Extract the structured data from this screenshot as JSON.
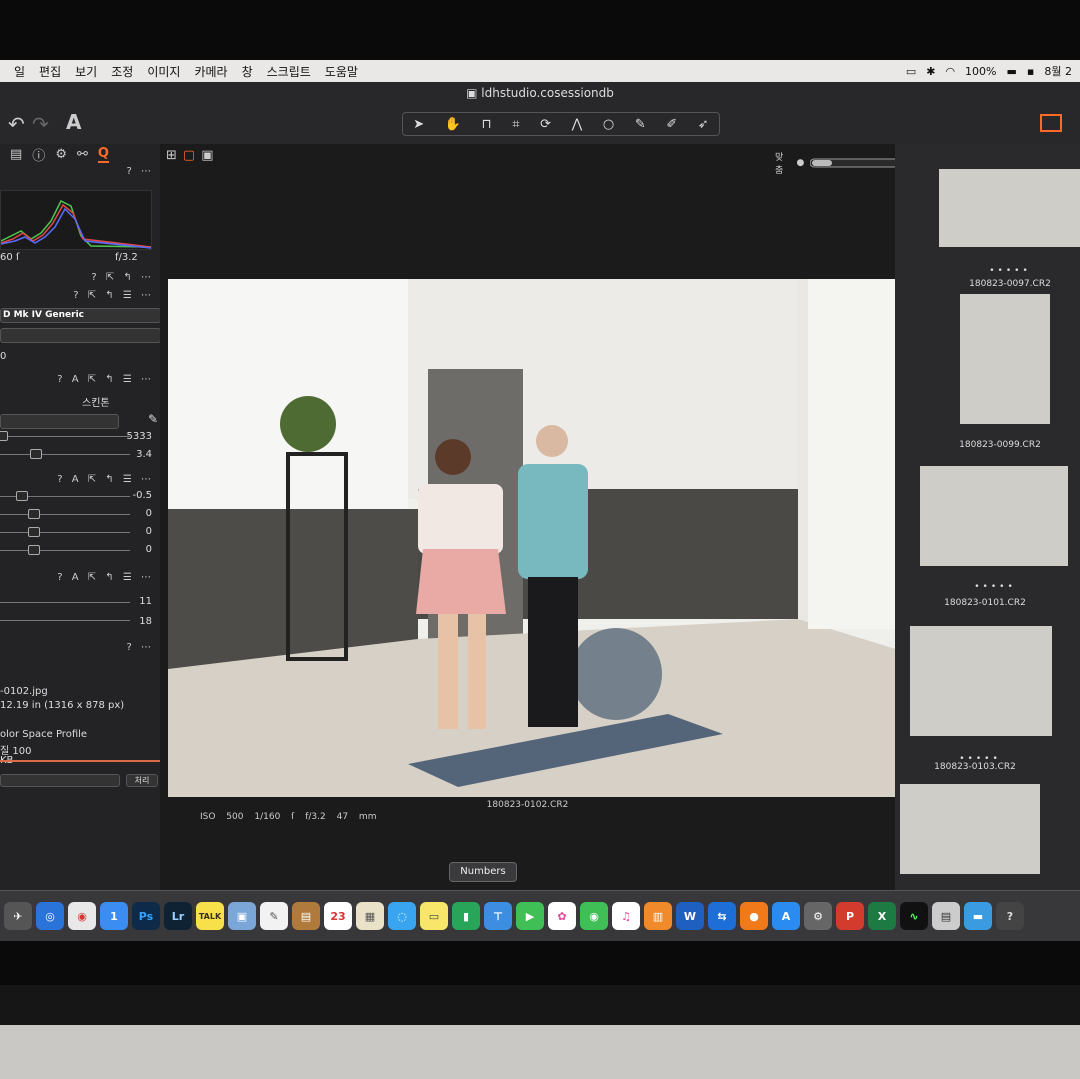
{
  "menubar": {
    "items": [
      "일",
      "편집",
      "보기",
      "조정",
      "이미지",
      "카메라",
      "창",
      "스크립트",
      "도움말"
    ],
    "battery": "100%",
    "date": "8월 2"
  },
  "window": {
    "title": "ldhstudio.cosessiondb"
  },
  "toolbar": {
    "text_tool": "A"
  },
  "left_panel": {
    "histogram_shutter": "60 ſ",
    "histogram_aperture": "f/3.2",
    "profile": "D Mk IV Generic",
    "zero_value": "0",
    "skin_tab": "스킨톤",
    "wb_kelvin": "5333",
    "wb_tint": "3.4",
    "exposure": "-0.5",
    "contrast": "0",
    "brightness": "0",
    "saturation": "0",
    "clarity": "11",
    "structure": "18",
    "filename": "-0102.jpg",
    "size": "12.19 in (1316 x 878 px)",
    "color_space": "olor Space Profile",
    "quality": "질 100",
    "filesize": "KB",
    "process_button": "처리"
  },
  "viewer": {
    "zoom_label": "맞춤",
    "caption": "180823-0102.CR2",
    "iso": "ISO 500",
    "shutter": "1/160 ſ",
    "aperture": "f/3.2",
    "focal": "47 mm"
  },
  "filmstrip": {
    "labels": [
      "180823-0097.CR2",
      "180823-0099.CR2",
      "180823-0101.CR2",
      "180823-0103.CR2"
    ]
  },
  "dock": {
    "tooltip": "Numbers",
    "apps": [
      "Launchpad",
      "Safari",
      "Chrome",
      "1Password",
      "Ps",
      "Lr",
      "KakaoTalk",
      "Preview",
      "TextEdit",
      "Notes",
      "Calendar",
      "Photos",
      "Messages",
      "Stickies",
      "Numbers",
      "Keynote",
      "FaceTime",
      "Photos Library",
      "FaceTime Camera",
      "iTunes",
      "iBooks",
      "Word",
      "TeamViewer",
      "Blaze",
      "App Store",
      "Sys Prefs",
      "PowerPoint",
      "Excel",
      "Activity",
      "Scan",
      "Folder",
      "Help"
    ]
  }
}
